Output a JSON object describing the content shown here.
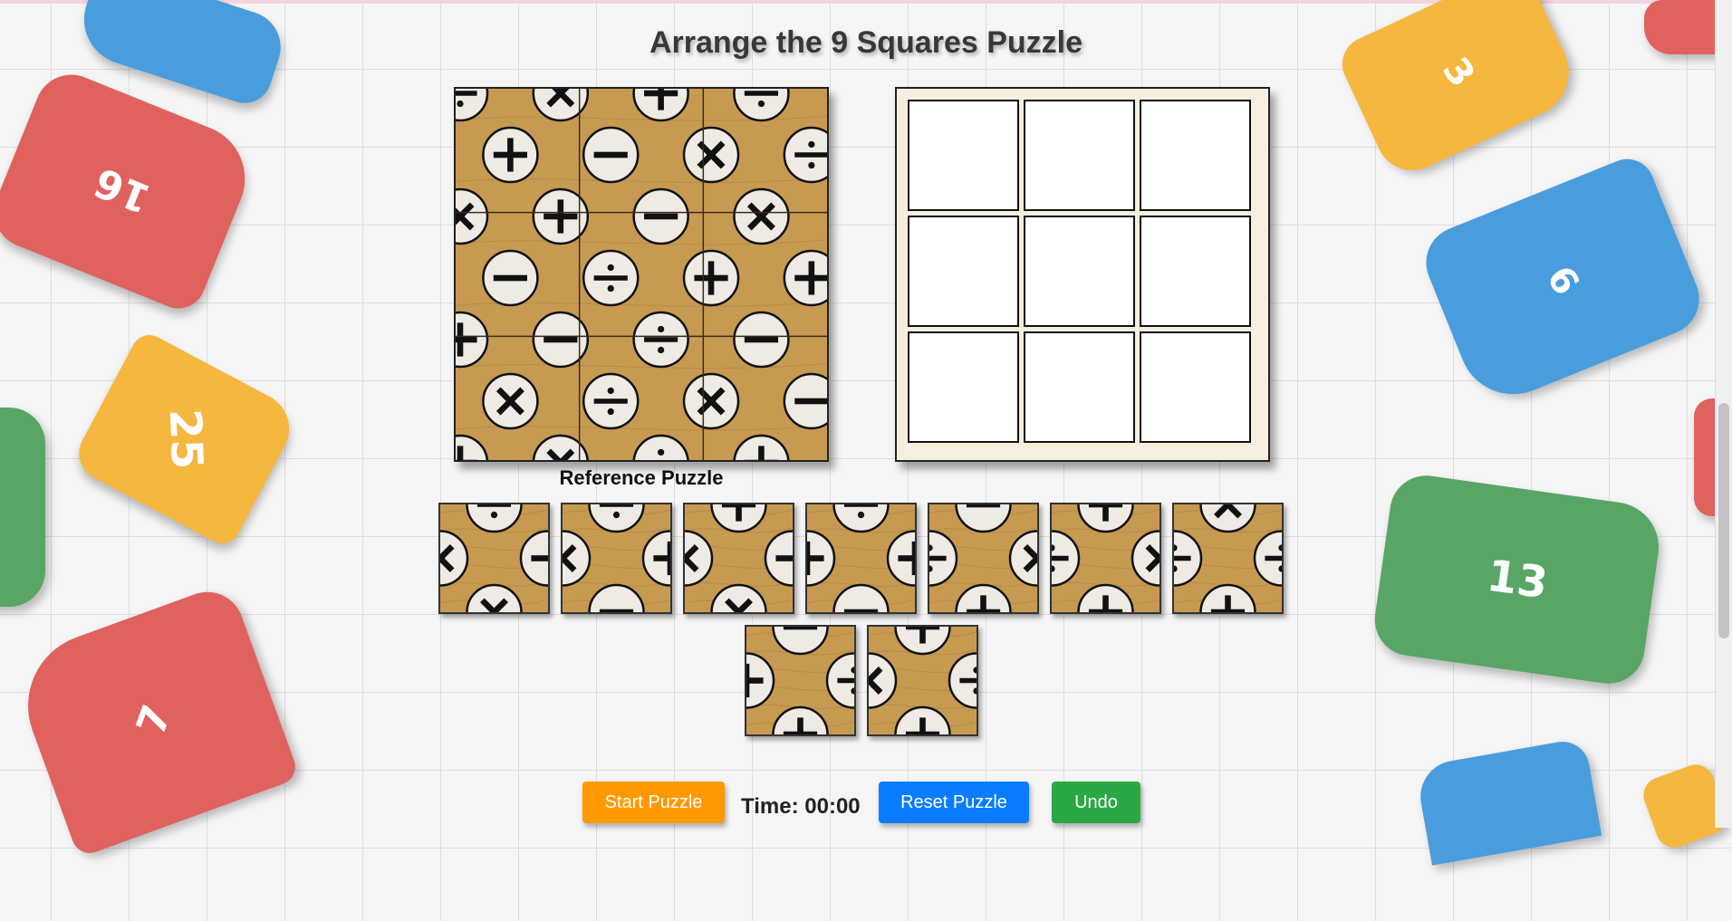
{
  "title": "Arrange the 9 Squares Puzzle",
  "reference_label": "Reference Puzzle",
  "controls": {
    "start_label": "Start Puzzle",
    "timer_label": "Time:",
    "timer_value": "00:00",
    "reset_label": "Reset Puzzle",
    "undo_label": "Undo"
  },
  "colors": {
    "tile_background": "#c79a52",
    "symbol_circle": "#efebe4",
    "symbol_ink": "#111111",
    "start_button": "#ff9900",
    "reset_button": "#0b7cff",
    "undo_button": "#2aa845"
  },
  "reference_symbols": [
    [
      "divide",
      "times",
      "plus",
      "divide"
    ],
    [
      "plus",
      "minus",
      "times",
      "divide"
    ],
    [
      "times",
      "plus",
      "minus",
      "times"
    ],
    [
      "minus",
      "divide",
      "plus",
      "plus"
    ],
    [
      "plus",
      "minus",
      "divide",
      "minus"
    ],
    [
      "times",
      "divide",
      "times",
      "minus"
    ],
    [
      "plus",
      "times",
      "divide",
      "plus"
    ]
  ],
  "target_slots": 9,
  "pieces_count": 9,
  "decorations": [
    {
      "color": "red",
      "number": "16"
    },
    {
      "color": "blue",
      "number": ""
    },
    {
      "color": "yellow",
      "number": "25"
    },
    {
      "color": "red",
      "number": "7"
    },
    {
      "color": "green",
      "number": ""
    },
    {
      "color": "yellow",
      "number": "3"
    },
    {
      "color": "blue",
      "number": "6"
    },
    {
      "color": "green",
      "number": "13"
    },
    {
      "color": "red",
      "number": ""
    },
    {
      "color": "blue",
      "number": ""
    }
  ]
}
